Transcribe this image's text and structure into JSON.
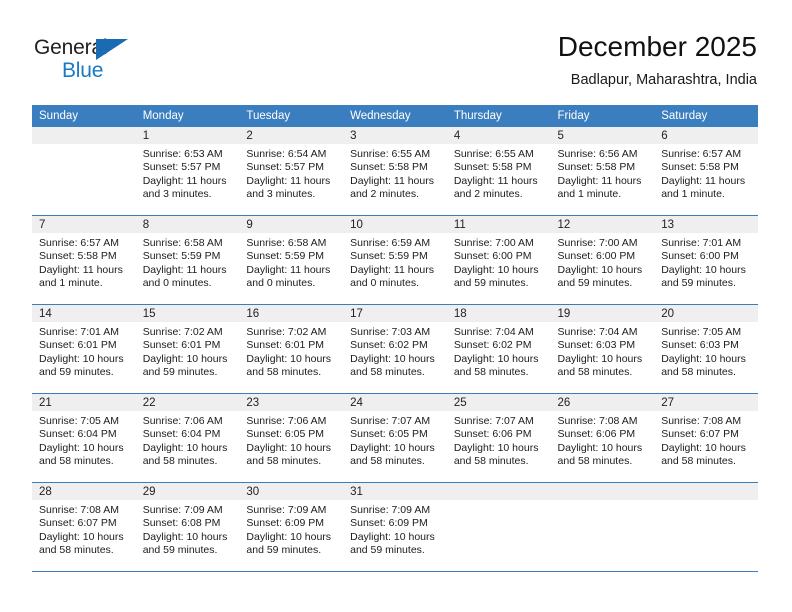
{
  "brand": {
    "name_part1": "General",
    "name_part2": "Blue",
    "triangle_icon": "triangle-logo-mark",
    "color_dark": "#231f20",
    "color_blue": "#1a7ac4"
  },
  "header": {
    "title": "December 2025",
    "subtitle": "Badlapur, Maharashtra, India"
  },
  "calendar": {
    "header_bg": "#3a7ebf",
    "daynum_bg": "#efefef",
    "rule_color": "#3a7ebf",
    "weekday_headers": [
      "Sunday",
      "Monday",
      "Tuesday",
      "Wednesday",
      "Thursday",
      "Friday",
      "Saturday"
    ],
    "weeks": [
      [
        {
          "day": "",
          "sunrise": "",
          "sunset": "",
          "daylight_line1": "",
          "daylight_line2": ""
        },
        {
          "day": "1",
          "sunrise": "Sunrise: 6:53 AM",
          "sunset": "Sunset: 5:57 PM",
          "daylight_line1": "Daylight: 11 hours",
          "daylight_line2": "and 3 minutes."
        },
        {
          "day": "2",
          "sunrise": "Sunrise: 6:54 AM",
          "sunset": "Sunset: 5:57 PM",
          "daylight_line1": "Daylight: 11 hours",
          "daylight_line2": "and 3 minutes."
        },
        {
          "day": "3",
          "sunrise": "Sunrise: 6:55 AM",
          "sunset": "Sunset: 5:58 PM",
          "daylight_line1": "Daylight: 11 hours",
          "daylight_line2": "and 2 minutes."
        },
        {
          "day": "4",
          "sunrise": "Sunrise: 6:55 AM",
          "sunset": "Sunset: 5:58 PM",
          "daylight_line1": "Daylight: 11 hours",
          "daylight_line2": "and 2 minutes."
        },
        {
          "day": "5",
          "sunrise": "Sunrise: 6:56 AM",
          "sunset": "Sunset: 5:58 PM",
          "daylight_line1": "Daylight: 11 hours",
          "daylight_line2": "and 1 minute."
        },
        {
          "day": "6",
          "sunrise": "Sunrise: 6:57 AM",
          "sunset": "Sunset: 5:58 PM",
          "daylight_line1": "Daylight: 11 hours",
          "daylight_line2": "and 1 minute."
        }
      ],
      [
        {
          "day": "7",
          "sunrise": "Sunrise: 6:57 AM",
          "sunset": "Sunset: 5:58 PM",
          "daylight_line1": "Daylight: 11 hours",
          "daylight_line2": "and 1 minute."
        },
        {
          "day": "8",
          "sunrise": "Sunrise: 6:58 AM",
          "sunset": "Sunset: 5:59 PM",
          "daylight_line1": "Daylight: 11 hours",
          "daylight_line2": "and 0 minutes."
        },
        {
          "day": "9",
          "sunrise": "Sunrise: 6:58 AM",
          "sunset": "Sunset: 5:59 PM",
          "daylight_line1": "Daylight: 11 hours",
          "daylight_line2": "and 0 minutes."
        },
        {
          "day": "10",
          "sunrise": "Sunrise: 6:59 AM",
          "sunset": "Sunset: 5:59 PM",
          "daylight_line1": "Daylight: 11 hours",
          "daylight_line2": "and 0 minutes."
        },
        {
          "day": "11",
          "sunrise": "Sunrise: 7:00 AM",
          "sunset": "Sunset: 6:00 PM",
          "daylight_line1": "Daylight: 10 hours",
          "daylight_line2": "and 59 minutes."
        },
        {
          "day": "12",
          "sunrise": "Sunrise: 7:00 AM",
          "sunset": "Sunset: 6:00 PM",
          "daylight_line1": "Daylight: 10 hours",
          "daylight_line2": "and 59 minutes."
        },
        {
          "day": "13",
          "sunrise": "Sunrise: 7:01 AM",
          "sunset": "Sunset: 6:00 PM",
          "daylight_line1": "Daylight: 10 hours",
          "daylight_line2": "and 59 minutes."
        }
      ],
      [
        {
          "day": "14",
          "sunrise": "Sunrise: 7:01 AM",
          "sunset": "Sunset: 6:01 PM",
          "daylight_line1": "Daylight: 10 hours",
          "daylight_line2": "and 59 minutes."
        },
        {
          "day": "15",
          "sunrise": "Sunrise: 7:02 AM",
          "sunset": "Sunset: 6:01 PM",
          "daylight_line1": "Daylight: 10 hours",
          "daylight_line2": "and 59 minutes."
        },
        {
          "day": "16",
          "sunrise": "Sunrise: 7:02 AM",
          "sunset": "Sunset: 6:01 PM",
          "daylight_line1": "Daylight: 10 hours",
          "daylight_line2": "and 58 minutes."
        },
        {
          "day": "17",
          "sunrise": "Sunrise: 7:03 AM",
          "sunset": "Sunset: 6:02 PM",
          "daylight_line1": "Daylight: 10 hours",
          "daylight_line2": "and 58 minutes."
        },
        {
          "day": "18",
          "sunrise": "Sunrise: 7:04 AM",
          "sunset": "Sunset: 6:02 PM",
          "daylight_line1": "Daylight: 10 hours",
          "daylight_line2": "and 58 minutes."
        },
        {
          "day": "19",
          "sunrise": "Sunrise: 7:04 AM",
          "sunset": "Sunset: 6:03 PM",
          "daylight_line1": "Daylight: 10 hours",
          "daylight_line2": "and 58 minutes."
        },
        {
          "day": "20",
          "sunrise": "Sunrise: 7:05 AM",
          "sunset": "Sunset: 6:03 PM",
          "daylight_line1": "Daylight: 10 hours",
          "daylight_line2": "and 58 minutes."
        }
      ],
      [
        {
          "day": "21",
          "sunrise": "Sunrise: 7:05 AM",
          "sunset": "Sunset: 6:04 PM",
          "daylight_line1": "Daylight: 10 hours",
          "daylight_line2": "and 58 minutes."
        },
        {
          "day": "22",
          "sunrise": "Sunrise: 7:06 AM",
          "sunset": "Sunset: 6:04 PM",
          "daylight_line1": "Daylight: 10 hours",
          "daylight_line2": "and 58 minutes."
        },
        {
          "day": "23",
          "sunrise": "Sunrise: 7:06 AM",
          "sunset": "Sunset: 6:05 PM",
          "daylight_line1": "Daylight: 10 hours",
          "daylight_line2": "and 58 minutes."
        },
        {
          "day": "24",
          "sunrise": "Sunrise: 7:07 AM",
          "sunset": "Sunset: 6:05 PM",
          "daylight_line1": "Daylight: 10 hours",
          "daylight_line2": "and 58 minutes."
        },
        {
          "day": "25",
          "sunrise": "Sunrise: 7:07 AM",
          "sunset": "Sunset: 6:06 PM",
          "daylight_line1": "Daylight: 10 hours",
          "daylight_line2": "and 58 minutes."
        },
        {
          "day": "26",
          "sunrise": "Sunrise: 7:08 AM",
          "sunset": "Sunset: 6:06 PM",
          "daylight_line1": "Daylight: 10 hours",
          "daylight_line2": "and 58 minutes."
        },
        {
          "day": "27",
          "sunrise": "Sunrise: 7:08 AM",
          "sunset": "Sunset: 6:07 PM",
          "daylight_line1": "Daylight: 10 hours",
          "daylight_line2": "and 58 minutes."
        }
      ],
      [
        {
          "day": "28",
          "sunrise": "Sunrise: 7:08 AM",
          "sunset": "Sunset: 6:07 PM",
          "daylight_line1": "Daylight: 10 hours",
          "daylight_line2": "and 58 minutes."
        },
        {
          "day": "29",
          "sunrise": "Sunrise: 7:09 AM",
          "sunset": "Sunset: 6:08 PM",
          "daylight_line1": "Daylight: 10 hours",
          "daylight_line2": "and 59 minutes."
        },
        {
          "day": "30",
          "sunrise": "Sunrise: 7:09 AM",
          "sunset": "Sunset: 6:09 PM",
          "daylight_line1": "Daylight: 10 hours",
          "daylight_line2": "and 59 minutes."
        },
        {
          "day": "31",
          "sunrise": "Sunrise: 7:09 AM",
          "sunset": "Sunset: 6:09 PM",
          "daylight_line1": "Daylight: 10 hours",
          "daylight_line2": "and 59 minutes."
        },
        {
          "day": "",
          "sunrise": "",
          "sunset": "",
          "daylight_line1": "",
          "daylight_line2": ""
        },
        {
          "day": "",
          "sunrise": "",
          "sunset": "",
          "daylight_line1": "",
          "daylight_line2": ""
        },
        {
          "day": "",
          "sunrise": "",
          "sunset": "",
          "daylight_line1": "",
          "daylight_line2": ""
        }
      ]
    ]
  }
}
